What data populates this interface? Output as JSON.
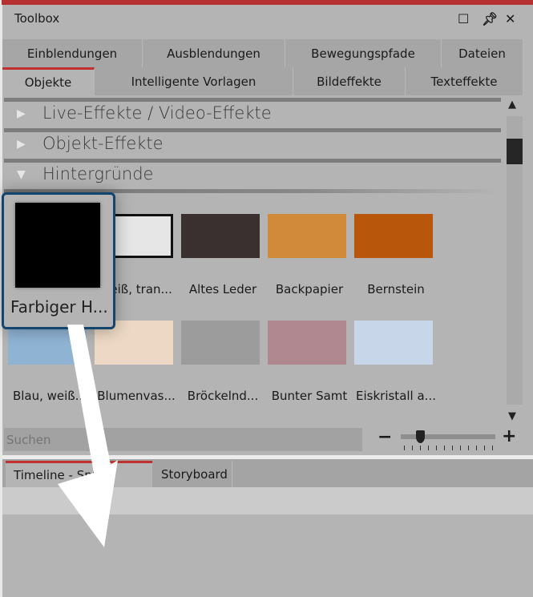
{
  "window": {
    "title": "Toolbox",
    "icons": [
      "maximize-icon",
      "pin-icon",
      "close-icon"
    ]
  },
  "tabs_row1": [
    "Einblendungen",
    "Ausblendungen",
    "Bewegungspfade",
    "Dateien"
  ],
  "tabs_row2": [
    "Objekte",
    "Intelligente Vorlagen",
    "Bildeffekte",
    "Texteffekte"
  ],
  "active_tab": "Objekte",
  "sections": [
    {
      "label": "Live-Effekte / Video-Effekte",
      "expanded": false
    },
    {
      "label": "Objekt-Effekte",
      "expanded": false
    },
    {
      "label": "Hintergründe",
      "expanded": true
    }
  ],
  "items": [
    {
      "label": "Farbiger H...",
      "fill": "#000000"
    },
    {
      "label": "weiß, tran...",
      "fill": "#e6e6e6"
    },
    {
      "label": "Altes Leder",
      "fill": "#3a3030"
    },
    {
      "label": "Backpapier",
      "fill": "#d08a3a"
    },
    {
      "label": "Bernstein",
      "fill": "#b8560c"
    },
    {
      "label": "Blau, weiß...",
      "fill": "#8fb3d3"
    },
    {
      "label": "Blumenvas...",
      "fill": "#ecd8c4"
    },
    {
      "label": "Bröckelnd...",
      "fill": "#9c9c9c"
    },
    {
      "label": "Bunter Samt",
      "fill": "#b08890"
    },
    {
      "label": "Eiskristall a...",
      "fill": "#c8d6ea"
    }
  ],
  "search": {
    "placeholder": "Suchen"
  },
  "zoom": {
    "minus": "−",
    "plus": "+",
    "level_fraction": 0.2
  },
  "drag_preview": {
    "label": "Farbiger H..."
  },
  "bottom_tabs": [
    "Timeline - Spur",
    "Storyboard"
  ],
  "colors": {
    "accent": "#c0302e",
    "drag_border": "#14456f"
  }
}
